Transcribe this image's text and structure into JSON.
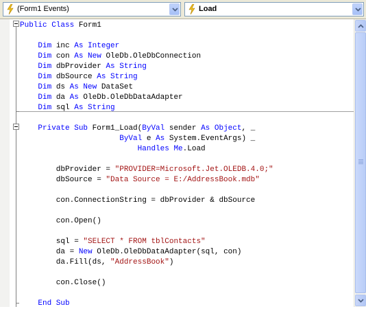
{
  "toolbar": {
    "object_combo": "(Form1 Events)",
    "member_combo": "Load"
  },
  "code": {
    "lines": [
      [
        {
          "t": "Public Class ",
          "c": "kw"
        },
        {
          "t": "Form1",
          "c": ""
        }
      ],
      [],
      [
        {
          "t": "    "
        },
        {
          "t": "Dim",
          "c": "kw"
        },
        {
          "t": " inc "
        },
        {
          "t": "As Integer",
          "c": "kw"
        }
      ],
      [
        {
          "t": "    "
        },
        {
          "t": "Dim",
          "c": "kw"
        },
        {
          "t": " con "
        },
        {
          "t": "As New",
          "c": "kw"
        },
        {
          "t": " OleDb.OleDbConnection"
        }
      ],
      [
        {
          "t": "    "
        },
        {
          "t": "Dim",
          "c": "kw"
        },
        {
          "t": " dbProvider "
        },
        {
          "t": "As String",
          "c": "kw"
        }
      ],
      [
        {
          "t": "    "
        },
        {
          "t": "Dim",
          "c": "kw"
        },
        {
          "t": " dbSource "
        },
        {
          "t": "As String",
          "c": "kw"
        }
      ],
      [
        {
          "t": "    "
        },
        {
          "t": "Dim",
          "c": "kw"
        },
        {
          "t": " ds "
        },
        {
          "t": "As New",
          "c": "kw"
        },
        {
          "t": " DataSet"
        }
      ],
      [
        {
          "t": "    "
        },
        {
          "t": "Dim",
          "c": "kw"
        },
        {
          "t": " da "
        },
        {
          "t": "As",
          "c": "kw"
        },
        {
          "t": " OleDb.OleDbDataAdapter"
        }
      ],
      [
        {
          "t": "    "
        },
        {
          "t": "Dim",
          "c": "kw"
        },
        {
          "t": " sql "
        },
        {
          "t": "As String",
          "c": "kw"
        }
      ],
      [],
      [
        {
          "t": "    "
        },
        {
          "t": "Private Sub",
          "c": "kw"
        },
        {
          "t": " Form1_Load("
        },
        {
          "t": "ByVal",
          "c": "kw"
        },
        {
          "t": " sender "
        },
        {
          "t": "As Object",
          "c": "kw"
        },
        {
          "t": ", _"
        }
      ],
      [
        {
          "t": "                      "
        },
        {
          "t": "ByVal",
          "c": "kw"
        },
        {
          "t": " e "
        },
        {
          "t": "As",
          "c": "kw"
        },
        {
          "t": " System.EventArgs) _"
        }
      ],
      [
        {
          "t": "                          "
        },
        {
          "t": "Handles Me",
          "c": "kw"
        },
        {
          "t": ".Load"
        }
      ],
      [],
      [
        {
          "t": "        dbProvider = "
        },
        {
          "t": "\"PROVIDER=Microsoft.Jet.OLEDB.4.0;\"",
          "c": "str"
        }
      ],
      [
        {
          "t": "        dbSource = "
        },
        {
          "t": "\"Data Source = E:/AddressBook.mdb\"",
          "c": "str"
        }
      ],
      [],
      [
        {
          "t": "        con.ConnectionString = dbProvider & dbSource"
        }
      ],
      [],
      [
        {
          "t": "        con.Open()"
        }
      ],
      [],
      [
        {
          "t": "        sql = "
        },
        {
          "t": "\"SELECT * FROM tblContacts\"",
          "c": "str"
        }
      ],
      [
        {
          "t": "        da = "
        },
        {
          "t": "New",
          "c": "kw"
        },
        {
          "t": " OleDb.OleDbDataAdapter(sql, con)"
        }
      ],
      [
        {
          "t": "        da.Fill(ds, "
        },
        {
          "t": "\"AddressBook\"",
          "c": "str"
        },
        {
          "t": ")"
        }
      ],
      [],
      [
        {
          "t": "        con.Close()"
        }
      ],
      [],
      [
        {
          "t": "    "
        },
        {
          "t": "End Sub",
          "c": "kw"
        }
      ]
    ]
  }
}
